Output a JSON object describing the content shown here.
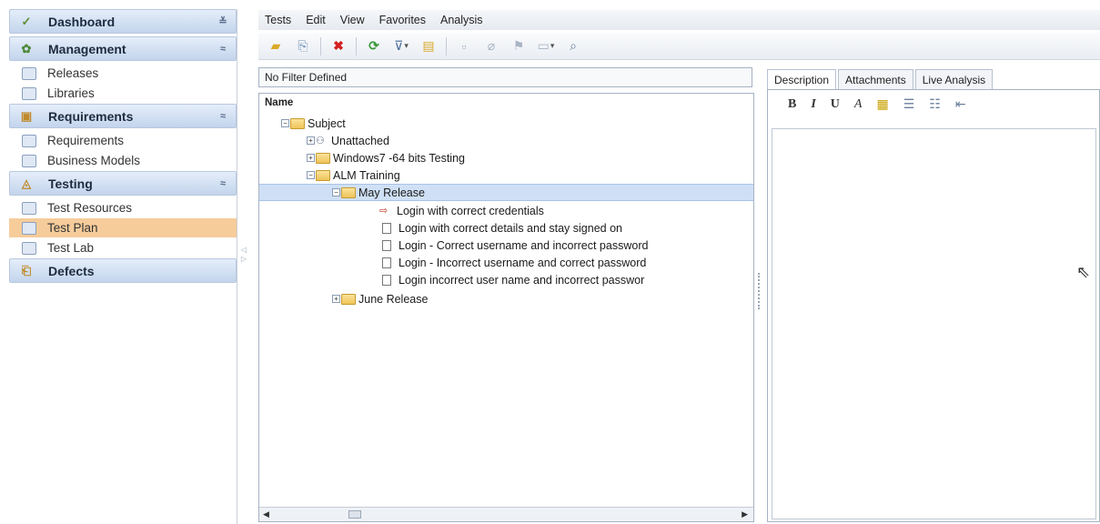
{
  "sidebar": {
    "sections": [
      {
        "label": "Dashboard",
        "chevron": "≚"
      },
      {
        "label": "Management",
        "chevron": "≈"
      },
      {
        "label": "Requirements",
        "chevron": "≈"
      },
      {
        "label": "Testing",
        "chevron": "≈"
      },
      {
        "label": "Defects"
      }
    ],
    "items": {
      "releases": "Releases",
      "libraries": "Libraries",
      "requirements": "Requirements",
      "business_models": "Business Models",
      "test_resources": "Test Resources",
      "test_plan": "Test Plan",
      "test_lab": "Test Lab"
    }
  },
  "menu": [
    "Tests",
    "Edit",
    "View",
    "Favorites",
    "Analysis"
  ],
  "filter_text": "No Filter Defined",
  "tree": {
    "column_header": "Name",
    "nodes": {
      "subject": "Subject",
      "unattached": "Unattached",
      "windows7": "Windows7 -64 bits Testing",
      "alm_training": "ALM Training",
      "may_release": "May Release",
      "test1": "Login with correct credentials",
      "test2": "Login with correct details and stay signed on",
      "test3": "Login - Correct username and incorrect password",
      "test4": "Login - Incorrect username and correct password",
      "test5": "Login incorrect user name and incorrect passwor",
      "june_release": "June Release"
    }
  },
  "tabs": [
    "Description",
    "Attachments",
    "Live Analysis"
  ],
  "format_toolbar": {
    "bold": "B",
    "italic": "I",
    "underline": "U",
    "font": "A"
  },
  "colors": {
    "selected_nav": "#f6cc9b",
    "selected_tree_row": "#cfe0f6",
    "section_header": "#c3d4ec"
  }
}
